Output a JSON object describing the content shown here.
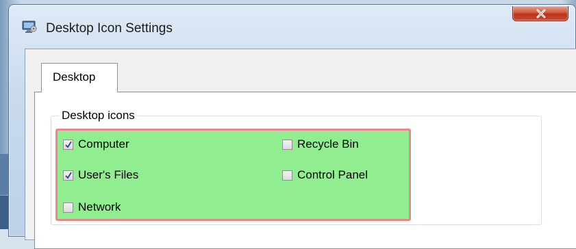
{
  "window": {
    "title": "Desktop Icon Settings",
    "app_icon": "desktop-settings-icon",
    "close_icon": "close-icon"
  },
  "tabs": [
    {
      "label": "Desktop",
      "selected": true
    }
  ],
  "group": {
    "legend": "Desktop icons",
    "highlight_color": "#90ee90",
    "highlight_border_color": "#e8868c",
    "items": [
      {
        "label": "Computer",
        "checked": true
      },
      {
        "label": "User's Files",
        "checked": true
      },
      {
        "label": "Network",
        "checked": false
      },
      {
        "label": "Recycle Bin",
        "checked": false
      },
      {
        "label": "Control Panel",
        "checked": false
      }
    ]
  },
  "colors": {
    "check_mark": "#2f4f8f",
    "close_button": "#c9452b"
  }
}
